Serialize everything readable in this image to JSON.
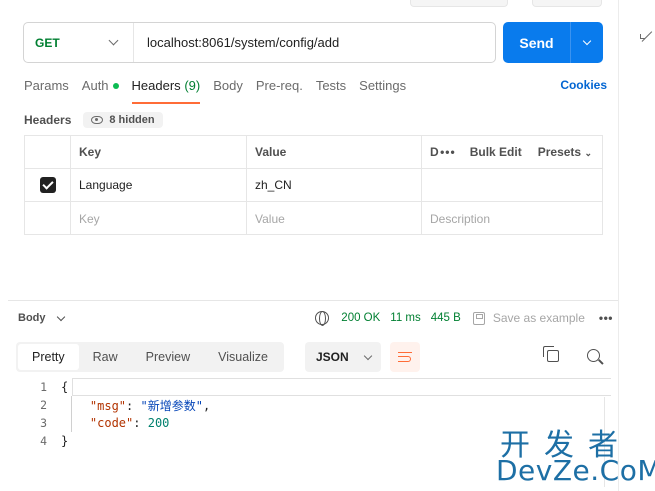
{
  "request": {
    "method": "GET",
    "url": "localhost:8061/system/config/add",
    "send_label": "Send"
  },
  "tabs": [
    {
      "label": "Params"
    },
    {
      "label": "Auth"
    },
    {
      "label": "Headers",
      "count": "(9)"
    },
    {
      "label": "Body"
    },
    {
      "label": "Pre-req."
    },
    {
      "label": "Tests"
    },
    {
      "label": "Settings"
    }
  ],
  "cookies_label": "Cookies",
  "headers_section": {
    "title": "Headers",
    "hidden_label": "8 hidden",
    "columns": {
      "key": "Key",
      "value": "Value",
      "description_stub": "D"
    },
    "bulk_edit": "Bulk Edit",
    "presets": "Presets",
    "rows": [
      {
        "checked": true,
        "key": "Language",
        "value": "zh_CN",
        "description": ""
      }
    ],
    "placeholders": {
      "key": "Key",
      "value": "Value",
      "description": "Description"
    }
  },
  "response": {
    "body_label": "Body",
    "status": "200 OK",
    "time": "11 ms",
    "size": "445 B",
    "save_label": "Save as example",
    "views": [
      "Pretty",
      "Raw",
      "Preview",
      "Visualize"
    ],
    "active_view": "Pretty",
    "format": "JSON",
    "lines": [
      {
        "n": "1",
        "text": "{"
      },
      {
        "n": "2",
        "key": "\"msg\"",
        "value": "\"新增参数\"",
        "suffix": ","
      },
      {
        "n": "3",
        "key": "\"code\"",
        "value": "200",
        "suffix": ""
      },
      {
        "n": "4",
        "text": "}"
      }
    ]
  },
  "watermark": {
    "cn": "开发者",
    "en": "DevZe.CoM"
  },
  "colors": {
    "accent": "#097bed",
    "tab_underline": "#ff6c37",
    "status_green": "#007f31",
    "method_green": "#007f31"
  },
  "icons": [
    "chevron-down-icon",
    "eye-icon",
    "checkbox-icon",
    "globe-icon",
    "save-icon",
    "more-icon",
    "wrap-icon",
    "copy-icon",
    "search-icon",
    "expand-icon"
  ]
}
